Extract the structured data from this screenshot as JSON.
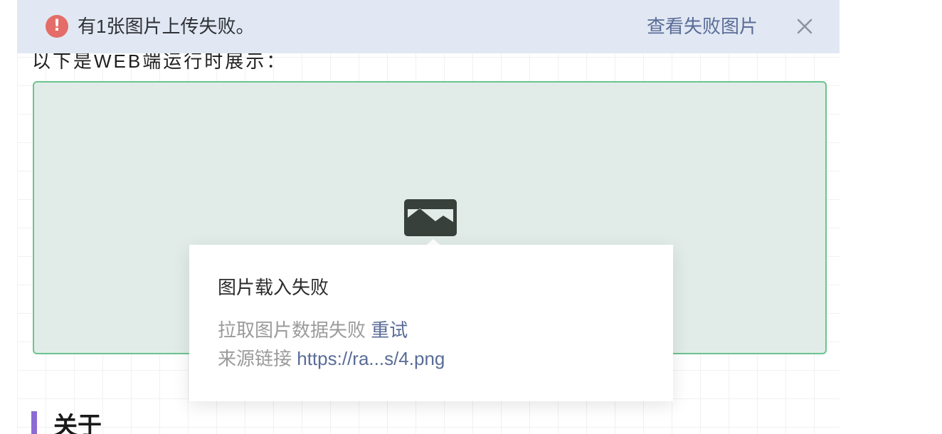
{
  "banner": {
    "icon": "exclamation-circle-icon",
    "icon_glyph": "!",
    "message": "有1张图片上传失败。",
    "view_link": "查看失败图片",
    "close_icon": "close-icon",
    "background_color": "#e1e8f3",
    "icon_color": "#e46d69"
  },
  "content": {
    "intro_text": "以下是WEB端运行时展示：",
    "image_placeholder_icon": "image-icon",
    "image_box_border_color": "#6cc38f",
    "image_box_background": "#e1ece8"
  },
  "popover": {
    "title": "图片载入失败",
    "fetch_error_text": "拉取图片数据失败",
    "retry_label": "重试",
    "source_label": "来源链接",
    "source_url": "https://ra...s/4.png",
    "link_color": "#5a6c97"
  },
  "section": {
    "heading": "关于",
    "accent_color": "#8c6ad6"
  }
}
